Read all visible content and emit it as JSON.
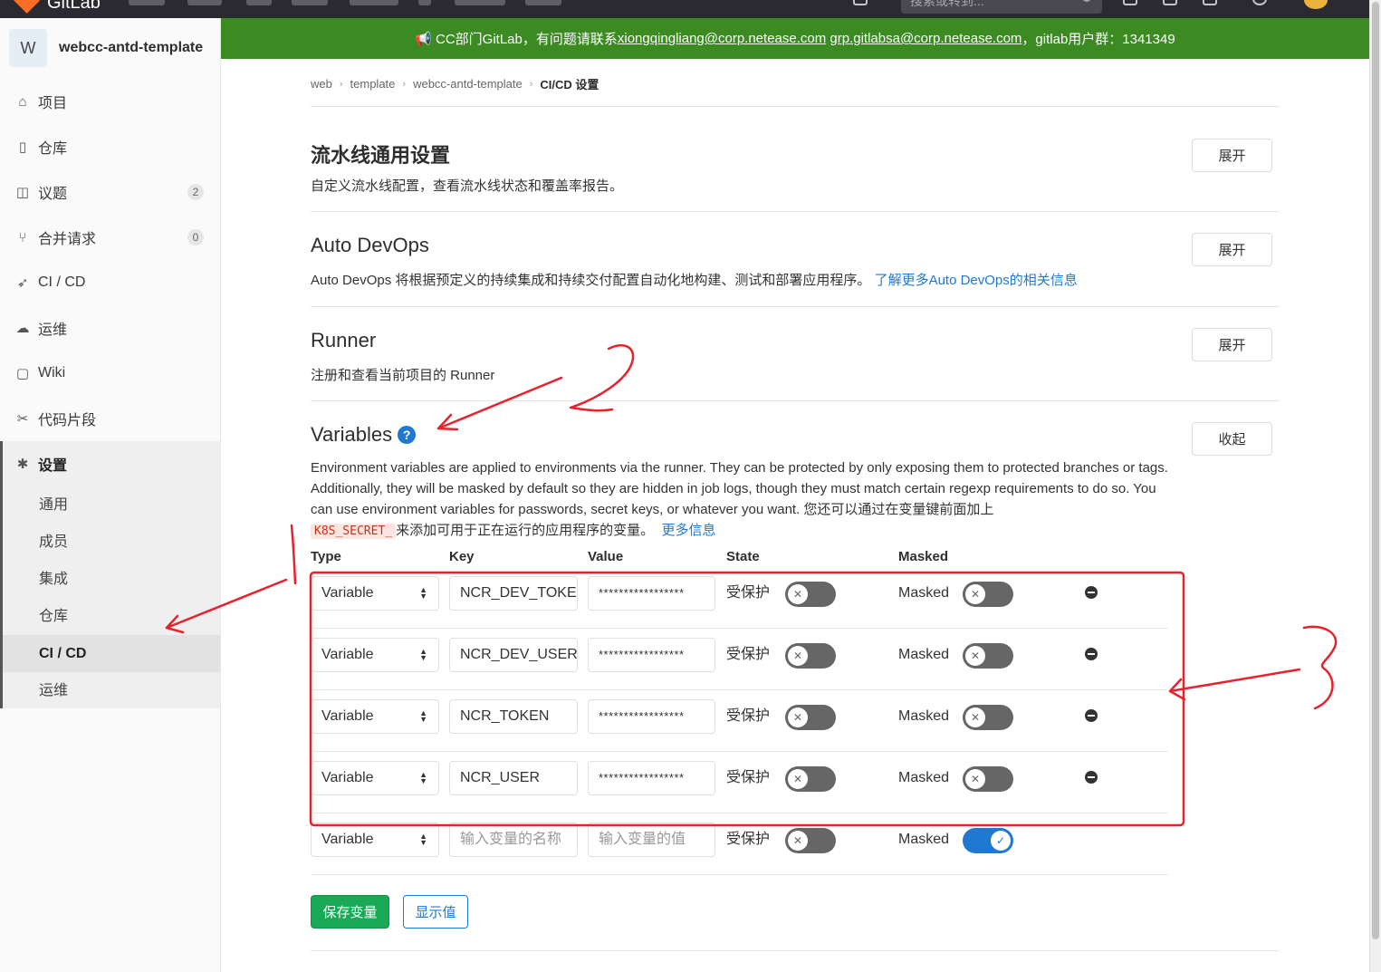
{
  "topnav": {
    "brand": "GitLab",
    "search_placeholder": "搜索或转到..."
  },
  "sidebar": {
    "project_avatar": "W",
    "project_name": "webcc-antd-template",
    "items": [
      {
        "label": "项目",
        "icon": "home-icon"
      },
      {
        "label": "仓库",
        "icon": "file-icon"
      },
      {
        "label": "议题",
        "icon": "issues-icon",
        "badge": "2"
      },
      {
        "label": "合并请求",
        "icon": "merge-request-icon",
        "badge": "0"
      },
      {
        "label": "CI / CD",
        "icon": "rocket-icon"
      },
      {
        "label": "运维",
        "icon": "cloud-gear-icon"
      },
      {
        "label": "Wiki",
        "icon": "book-icon"
      },
      {
        "label": "代码片段",
        "icon": "scissors-icon"
      },
      {
        "label": "设置",
        "icon": "settings-icon"
      }
    ],
    "sub_items": [
      "通用",
      "成员",
      "集成",
      "仓库",
      "CI / CD",
      "运维"
    ]
  },
  "banner": {
    "prefix": "CC部门GitLab，有问题请联系",
    "email1": "xiongqingliang@corp.netease.com",
    "email2": "grp.gitlabsa@corp.netease.com",
    "suffix": "，gitlab用户群：1341349"
  },
  "breadcrumbs": [
    "web",
    "template",
    "webcc-antd-template",
    "CI/CD 设置"
  ],
  "sections": {
    "pipeline": {
      "title": "流水线通用设置",
      "desc": "自定义流水线配置，查看流水线状态和覆盖率报告。",
      "button": "展开"
    },
    "devops": {
      "title": "Auto DevOps",
      "desc": "Auto DevOps 将根据预定义的持续集成和持续交付配置自动化地构建、测试和部署应用程序。",
      "link": "了解更多Auto DevOps的相关信息",
      "button": "展开"
    },
    "runner": {
      "title": "Runner",
      "desc": "注册和查看当前项目的 Runner",
      "button": "展开"
    },
    "variables": {
      "title": "Variables",
      "help": "?",
      "button": "收起",
      "desc": "Environment variables are applied to environments via the runner. They can be protected by only exposing them to protected branches or tags. Additionally, they will be masked by default so they are hidden in job logs, though they must match certain regexp requirements to do so. You can use environment variables for passwords, secret keys, or whatever you want. 您还可以通过在变量键前面加上",
      "code": "K8S_SECRET_",
      "desc_tail": "来添加可用于正在运行的应用程序的变量。",
      "more_link": "更多信息"
    }
  },
  "table": {
    "headers": {
      "type": "Type",
      "key": "Key",
      "value": "Value",
      "state": "State",
      "masked": "Masked"
    },
    "rows": [
      {
        "type": "Variable",
        "key": "NCR_DEV_TOKEN",
        "value": "*****************",
        "state": "受保护",
        "masked": "Masked"
      },
      {
        "type": "Variable",
        "key": "NCR_DEV_USER",
        "value": "*****************",
        "state": "受保护",
        "masked": "Masked"
      },
      {
        "type": "Variable",
        "key": "NCR_TOKEN",
        "value": "*****************",
        "state": "受保护",
        "masked": "Masked"
      },
      {
        "type": "Variable",
        "key": "NCR_USER",
        "value": "*****************",
        "state": "受保护",
        "masked": "Masked"
      }
    ],
    "new_row": {
      "type": "Variable",
      "key_placeholder": "输入变量的名称",
      "value_placeholder": "输入变量的值",
      "state": "受保护",
      "masked": "Masked"
    }
  },
  "actions": {
    "save": "保存变量",
    "reveal": "显示值"
  },
  "colors": {
    "banner": "#3b8a22",
    "primary": "#1f78d1",
    "success": "#1aaa55",
    "annotation": "#e8222d"
  }
}
